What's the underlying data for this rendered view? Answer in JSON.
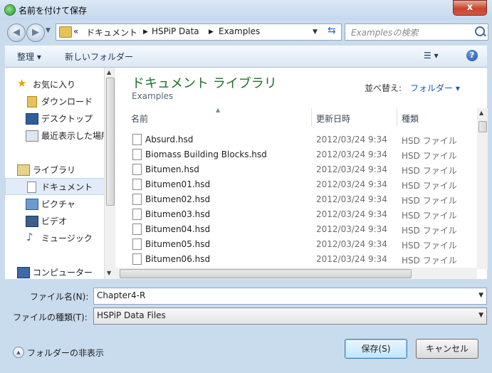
{
  "window": {
    "title": "名前を付けて保存",
    "close_label": "x"
  },
  "address": {
    "overflow": "«",
    "crumbs": [
      "ドキュメント",
      "HSPiP Data",
      "Examples"
    ]
  },
  "search": {
    "placeholder": "Examplesの検索"
  },
  "toolbar": {
    "organize": "整理 ▾",
    "new_folder": "新しいフォルダー",
    "view": "☰ ▾",
    "help": "?"
  },
  "sidebar": {
    "items": [
      {
        "label": "お気に入り",
        "icon": "star-icon"
      },
      {
        "label": "ダウンロード",
        "icon": "folder-icon"
      },
      {
        "label": "デスクトップ",
        "icon": "desktop-icon"
      },
      {
        "label": "最近表示した場所",
        "icon": "recent-icon"
      },
      {
        "label": "ライブラリ",
        "icon": "library-icon"
      },
      {
        "label": "ドキュメント",
        "icon": "document-icon"
      },
      {
        "label": "ピクチャ",
        "icon": "picture-icon"
      },
      {
        "label": "ビデオ",
        "icon": "video-icon"
      },
      {
        "label": "ミュージック",
        "icon": "music-icon"
      },
      {
        "label": "コンピューター",
        "icon": "computer-icon"
      }
    ]
  },
  "library": {
    "title": "ドキュメント ライブラリ",
    "subtitle": "Examples",
    "sort_label": "並べ替え:",
    "sort_value": "フォルダー ▾"
  },
  "columns": {
    "name": "名前",
    "date": "更新日時",
    "type": "種類"
  },
  "files": [
    {
      "name": "Absurd.hsd",
      "date": "2012/03/24 9:34",
      "type": "HSD ファイル"
    },
    {
      "name": "Biomass Building Blocks.hsd",
      "date": "2012/03/24 9:34",
      "type": "HSD ファイル"
    },
    {
      "name": "Bitumen.hsd",
      "date": "2012/03/24 9:34",
      "type": "HSD ファイル"
    },
    {
      "name": "Bitumen01.hsd",
      "date": "2012/03/24 9:34",
      "type": "HSD ファイル"
    },
    {
      "name": "Bitumen02.hsd",
      "date": "2012/03/24 9:34",
      "type": "HSD ファイル"
    },
    {
      "name": "Bitumen03.hsd",
      "date": "2012/03/24 9:34",
      "type": "HSD ファイル"
    },
    {
      "name": "Bitumen04.hsd",
      "date": "2012/03/24 9:34",
      "type": "HSD ファイル"
    },
    {
      "name": "Bitumen05.hsd",
      "date": "2012/03/24 9:34",
      "type": "HSD ファイル"
    },
    {
      "name": "Bitumen06.hsd",
      "date": "2012/03/24 9:34",
      "type": "HSD ファイル"
    }
  ],
  "form": {
    "filename_label": "ファイル名(N):",
    "filename_value": "Chapter4-R",
    "filetype_label": "ファイルの種類(T):",
    "filetype_value": "HSPiP Data Files",
    "hide_folders": "フォルダーの非表示",
    "save": "保存(S)",
    "cancel": "キャンセル"
  }
}
